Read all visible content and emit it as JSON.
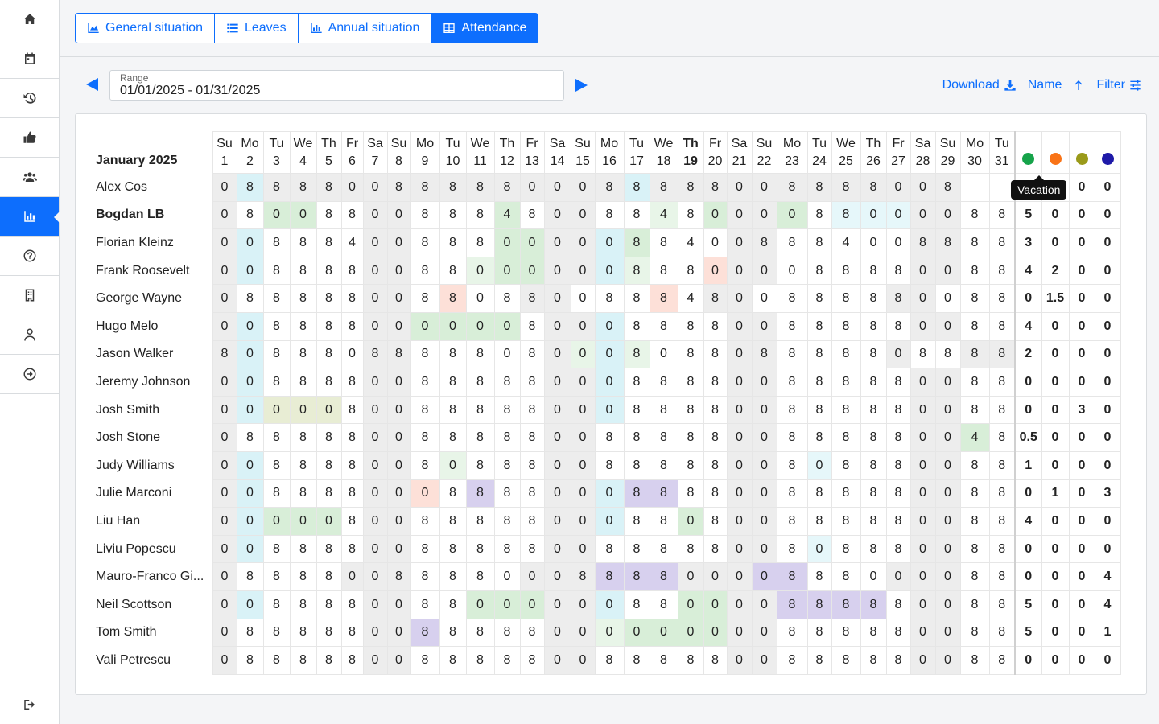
{
  "tabs": [
    {
      "label": "General situation",
      "icon": "area-chart-icon"
    },
    {
      "label": "Leaves",
      "icon": "list-icon"
    },
    {
      "label": "Annual situation",
      "icon": "bar-chart-icon"
    },
    {
      "label": "Attendance",
      "icon": "table-icon"
    }
  ],
  "range": {
    "label": "Range",
    "value": "01/01/2025 - 01/31/2025"
  },
  "actions": {
    "download": "Download",
    "name": "Name",
    "filter": "Filter"
  },
  "month_label": "January 2025",
  "days": [
    {
      "w": "Su",
      "d": "1"
    },
    {
      "w": "Mo",
      "d": "2"
    },
    {
      "w": "Tu",
      "d": "3"
    },
    {
      "w": "We",
      "d": "4"
    },
    {
      "w": "Th",
      "d": "5"
    },
    {
      "w": "Fr",
      "d": "6"
    },
    {
      "w": "Sa",
      "d": "7"
    },
    {
      "w": "Su",
      "d": "8"
    },
    {
      "w": "Mo",
      "d": "9"
    },
    {
      "w": "Tu",
      "d": "10"
    },
    {
      "w": "We",
      "d": "11"
    },
    {
      "w": "Th",
      "d": "12"
    },
    {
      "w": "Fr",
      "d": "13"
    },
    {
      "w": "Sa",
      "d": "14"
    },
    {
      "w": "Su",
      "d": "15"
    },
    {
      "w": "Mo",
      "d": "16"
    },
    {
      "w": "Tu",
      "d": "17"
    },
    {
      "w": "We",
      "d": "18"
    },
    {
      "w": "Th",
      "d": "19",
      "today": true
    },
    {
      "w": "Fr",
      "d": "20"
    },
    {
      "w": "Sa",
      "d": "21"
    },
    {
      "w": "Su",
      "d": "22"
    },
    {
      "w": "Mo",
      "d": "23"
    },
    {
      "w": "Tu",
      "d": "24"
    },
    {
      "w": "We",
      "d": "25"
    },
    {
      "w": "Th",
      "d": "26"
    },
    {
      "w": "Fr",
      "d": "27"
    },
    {
      "w": "Sa",
      "d": "28"
    },
    {
      "w": "Su",
      "d": "29"
    },
    {
      "w": "Mo",
      "d": "30"
    },
    {
      "w": "Tu",
      "d": "31"
    }
  ],
  "legend_colors": [
    "#16a34a",
    "#f97316",
    "#9a9a1a",
    "#1e1aa8"
  ],
  "tooltip": "Vacation",
  "rows": [
    {
      "name": "Alex Cos",
      "vals": "08888008888800088888008888008",
      "cls": "wpwwwwwwwwwwwwwwpwwwwwwwwwwww",
      "sum": [
        "",
        "0",
        "0",
        "0"
      ]
    },
    {
      "name": "Bogdan LB",
      "bold": true,
      "vals": "0800880088848008848000088000088",
      "cls": "w.gg..ww...g.ww..l.gwwg.sssww..",
      "sum": [
        "5",
        "0",
        "0",
        "0"
      ]
    },
    {
      "name": "Florian Kleinz",
      "vals": "0088840088800000884008884008888",
      "cls": "wp....ww...ggwwpg...ww.....ww..",
      "sum": [
        "3",
        "0",
        "0",
        "0"
      ]
    },
    {
      "name": "Frank Roosevelt",
      "vals": "0088880088000000888000088880088",
      "cls": "wp....ww..lggwwpl..oww.....ww..",
      "sum": [
        "4",
        "2",
        "0",
        "0"
      ]
    },
    {
      "name": "George Wayne",
      "vals": "0888880088088008884800888880088",
      "cls": "w.....ww.o..ww...o.ww.....ww..",
      "sum": [
        "0",
        "1.5",
        "0",
        "0"
      ]
    },
    {
      "name": "Hugo Melo",
      "vals": "0088880000008000888800888880088",
      "cls": "wp....wwgggg.wwp....ww.....ww..",
      "sum": [
        "4",
        "0",
        "0",
        "0"
      ]
    },
    {
      "name": "Jason Walker",
      "vals": "8088808888808000808808888808888",
      "cls": "wp....ww.....wlpl...ww....w..ww",
      "sum": [
        "2",
        "0",
        "0",
        "0"
      ]
    },
    {
      "name": "Jeremy Johnson",
      "vals": "0088880088888000888800888880088",
      "cls": "wp....ww.....wwp....ww.....ww..",
      "sum": [
        "0",
        "0",
        "0",
        "0"
      ]
    },
    {
      "name": "Josh Smith",
      "vals": "0000080088888000888800888880088",
      "cls": "wpyyy.ww.....wwp....ww.....ww..",
      "sum": [
        "0",
        "0",
        "3",
        "0"
      ]
    },
    {
      "name": "Josh Stone",
      "vals": "0888880088888008888800888880048",
      "cls": "w.....ww.....ww.....ww.....wwg.",
      "sum": [
        "0.5",
        "0",
        "0",
        "0"
      ]
    },
    {
      "name": "Judy Williams",
      "vals": "0088880080888008888800808880088",
      "cls": "wp....ww.l...ww.....ww.s...ww..",
      "sum": [
        "1",
        "0",
        "0",
        "0"
      ]
    },
    {
      "name": "Julie Marconi",
      "vals": "0088880008888000888800888880088",
      "cls": "wp....wwo.v..wwpvv..ww.....ww..",
      "sum": [
        "0",
        "1",
        "0",
        "3"
      ]
    },
    {
      "name": "Liu Han",
      "vals": "0000080088888000880800888880088",
      "cls": "wpggg.ww.....wwp..g.ww.....ww..",
      "sum": [
        "4",
        "0",
        "0",
        "0"
      ]
    },
    {
      "name": "Liviu Popescu",
      "vals": "0088880088888008888800808880088",
      "cls": "wp....ww.....ww.....ww.s...ww..",
      "sum": [
        "0",
        "0",
        "0",
        "0"
      ]
    },
    {
      "name": "Mauro-Franco Gi...",
      "vals": "0888800888800088880000888000088",
      "cls": "w....www....wwwvvvwwwvv...www..",
      "sum": [
        "0",
        "0",
        "0",
        "4"
      ]
    },
    {
      "name": "Neil Scottson",
      "vals": "0088880088000000880000888880088",
      "cls": "wp....ww..gggwwp..ggwwvvvv.ww..",
      "sum": [
        "5",
        "0",
        "0",
        "4"
      ]
    },
    {
      "name": "Tom Smith",
      "vals": "0888880088888000000000888880088",
      "cls": "w.....wwv....wwlggggww.....ww..",
      "sum": [
        "5",
        "0",
        "0",
        "1"
      ]
    },
    {
      "name": "Vali Petrescu",
      "vals": "0888880088888008888800888880088",
      "cls": "w.....ww.....ww.....ww.....ww..",
      "sum": [
        "0",
        "0",
        "0",
        "0"
      ]
    }
  ]
}
